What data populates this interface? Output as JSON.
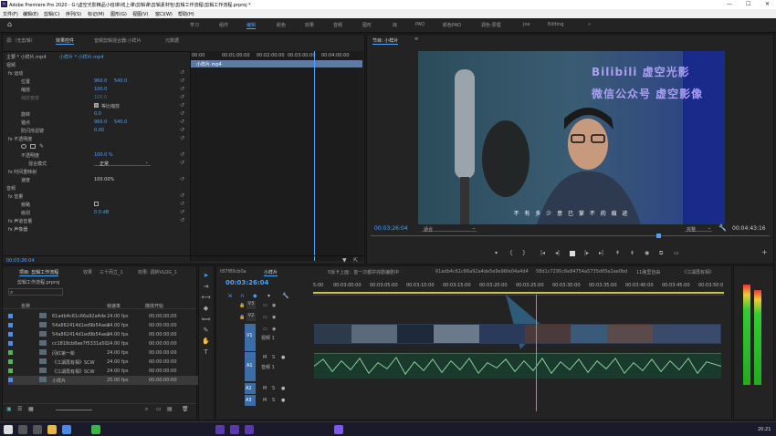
{
  "titlebar": {
    "title": "Adobe Premiere Pro 2020 - G:\\虚空光影精品小班课\\线上课\\剪辑课\\剪辑素材包\\剪辑工作流程\\剪辑工作流程.prproj *",
    "min": "—",
    "max": "☐",
    "close": "✕"
  },
  "menu": [
    "文件(F)",
    "编辑(E)",
    "剪辑(C)",
    "序列(S)",
    "标记(M)",
    "图形(G)",
    "视图(V)",
    "窗口(W)",
    "帮助(H)"
  ],
  "workspaces": [
    "学习",
    "组件",
    "编辑",
    "颜色",
    "效果",
    "音频",
    "图形",
    "库",
    "PAO",
    "颜色PAO",
    "调色·原理",
    "joe",
    "Editing"
  ],
  "effect_controls": {
    "tabs": [
      "源:（无剪辑）",
      "效果控件",
      "音频剪辑混合器:小样片",
      "元数据"
    ],
    "master": "主要 * 小样片.mp4",
    "clip": "小样片 * 小样片.mp4",
    "section_video": "视频",
    "rows": [
      {
        "name": "fx 运动"
      },
      {
        "name": "位置",
        "v1": "960.0",
        "v2": "540.0"
      },
      {
        "name": "缩放",
        "v1": "100.0"
      },
      {
        "name": "缩放宽度",
        "v1": "100.0"
      },
      {
        "name": "等比缩放"
      },
      {
        "name": "旋转",
        "v1": "0.0"
      },
      {
        "name": "锚点",
        "v1": "960.0",
        "v2": "540.0"
      },
      {
        "name": "防闪烁滤镜",
        "v1": "0.00"
      },
      {
        "name": "fx 不透明度"
      },
      {
        "name": "不透明度",
        "v1": "100.0 %"
      },
      {
        "name": "混合模式",
        "v1": "正常"
      },
      {
        "name": "fx 时间重映射"
      },
      {
        "name": "速度",
        "v1": "100.00%"
      },
      {
        "name": "音频"
      },
      {
        "name": "fx 音量"
      },
      {
        "name": "旁路"
      },
      {
        "name": "级别",
        "v1": "0.0 dB"
      },
      {
        "name": "fx 声道音量"
      },
      {
        "name": "fx 声像器"
      }
    ],
    "ruler": [
      "00:00",
      "00:01:00:00",
      "00:02:00:00",
      "00:03:00:00",
      "00:04:00:00"
    ],
    "clip_label": "小样片.mp4"
  },
  "program": {
    "title": "节目: 小样片",
    "watermark1": "Bilibili 虚空光影",
    "watermark2": "微信公众号 虚空影像",
    "subtitle": "不 有 多 少 意 已 掌 不 的 痕 迹",
    "timecode": "00:03:26:04",
    "fit": "适合",
    "quality": "完整",
    "duration": "00:04:43:16"
  },
  "project": {
    "tabs": [
      "项目: 剪辑工作流程",
      "效果",
      "三十而立_1",
      "效果: 调新VLOG_1"
    ],
    "name": "剪辑工作流程.prproj",
    "col_name": "名称",
    "col_fps": "帧速率",
    "col_start": "媒体开始",
    "items": [
      {
        "name": "61adb4c61c66a92a4de",
        "fps": "24.00 fps",
        "start": "00;00;00;00",
        "color": "#4f8fe0"
      },
      {
        "name": "54a862414d1ed9b54aea",
        "fps": "24.00 fps",
        "start": "00:00:00:00",
        "color": "#4f8fe0"
      },
      {
        "name": "54a862414d1ed9b54aea",
        "fps": "24.00 fps",
        "start": "00:00:00:00",
        "color": "#4f8fe0"
      },
      {
        "name": "cc1818cb8ae7f5331a50",
        "fps": "24.00 fps",
        "start": "00:00:00:00",
        "color": "#4f8fe0"
      },
      {
        "name": "闪红第一新",
        "fps": "24.00 fps",
        "start": "00:00:00:00",
        "color": "#55b555"
      },
      {
        "name": "《江湖再有相》SCW",
        "fps": "24.00 fps",
        "start": "00:00:00:00",
        "color": "#55b555"
      },
      {
        "name": "《江湖再有相》SCW",
        "fps": "24.00 fps",
        "start": "00:00:00:00",
        "color": "#55b555"
      },
      {
        "name": "小样片",
        "fps": "25.00 fps",
        "start": "00:00:00:00",
        "color": "#4f8fe0"
      }
    ]
  },
  "timeline": {
    "tabs": [
      "t87f89cb0a",
      "小样片",
      "5饭卡上面：首一次都并完剧编剧中",
      "61adb4c61c66a92a4de5e9e96fe04a4d4",
      "58d1c7295c6e84754a5735d65e2ae0bd",
      "11路里自由",
      "《江湖再有相》"
    ],
    "timecode": "00:03:26:04",
    "ruler": [
      "5:00",
      "00:03:00:00",
      "00:03:05:00",
      "00:03:10:00",
      "00:03:15:00",
      "00:03:20:00",
      "00:03:25:00",
      "00:03:30:00",
      "00:03:35:00",
      "00:03:40:00",
      "00:03:45:00",
      "00:03:50:0"
    ],
    "tracks": [
      "V3",
      "V2",
      "V1",
      "A1",
      "A2",
      "A3"
    ],
    "v1_label": "视频 1",
    "a1_label": "音频 1"
  },
  "taskbar": {
    "time": "20:21"
  }
}
